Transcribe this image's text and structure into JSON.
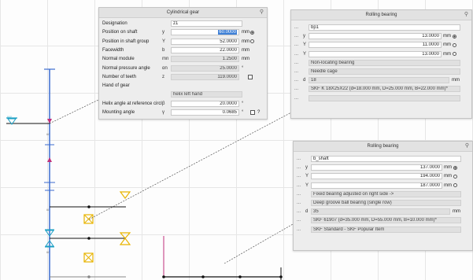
{
  "cylindrical_gear": {
    "title": "Cylindrical gear",
    "fields": [
      {
        "label": "Designation",
        "symbol": "",
        "value": "z1",
        "unit": "",
        "type": "text"
      },
      {
        "label": "Position on shaft",
        "symbol": "y",
        "value": "60.0000",
        "unit": "mm",
        "type": "num-selected",
        "radio": "on"
      },
      {
        "label": "Position in shaft group",
        "symbol": "Y",
        "value": "52.0000",
        "unit": "mm",
        "type": "num",
        "radio": "off"
      },
      {
        "label": "Facewidth",
        "symbol": "b",
        "value": "22.0000",
        "unit": "mm",
        "type": "num"
      },
      {
        "label": "Normal module",
        "symbol": "mn",
        "value": "1.2500",
        "unit": "mm",
        "type": "num-ro"
      },
      {
        "label": "Normal pressure angle",
        "symbol": "αn",
        "value": "25.0000",
        "unit": "°",
        "type": "num-ro"
      },
      {
        "label": "Number of teeth",
        "symbol": "z",
        "value": "119.0000",
        "unit": "",
        "type": "num-ro",
        "check": true
      },
      {
        "label": "Hand of gear",
        "symbol": "",
        "value": "",
        "unit": "",
        "type": "none"
      },
      {
        "label": "",
        "symbol": "",
        "value": "helix left hand",
        "unit": "",
        "type": "text-ro"
      },
      {
        "label": "Helix angle at reference circle",
        "symbol": "β",
        "value": "20.0000",
        "unit": "°",
        "type": "num"
      },
      {
        "label": "Mounting angle",
        "symbol": "γ",
        "value": "0.0685",
        "unit": "°",
        "type": "num",
        "check": true,
        "extra": "?"
      }
    ]
  },
  "rolling_bearing_1": {
    "title": "Rolling bearing",
    "rows": [
      {
        "dots": "...",
        "symbol": "",
        "value": "bp1",
        "unit": "",
        "type": "text"
      },
      {
        "dots": "...",
        "symbol": "y",
        "value": "13.0000",
        "unit": "mm",
        "type": "num",
        "radio": "on"
      },
      {
        "dots": "...",
        "symbol": "Y",
        "value": "11.0000",
        "unit": "mm",
        "type": "num",
        "radio": "off"
      },
      {
        "dots": "...",
        "symbol": "Y",
        "value": "13.0000",
        "unit": "mm",
        "type": "num",
        "radio": "off"
      },
      {
        "dots": "...",
        "symbol": "",
        "value": "Non-locating bearing",
        "unit": "",
        "type": "text-ro"
      },
      {
        "dots": "...",
        "symbol": "",
        "value": "Needle cage",
        "unit": "",
        "type": "text-ro"
      },
      {
        "dots": "...",
        "symbol": "d",
        "value": "18",
        "unit": "mm",
        "type": "text-ro"
      },
      {
        "dots": "...",
        "symbol": "",
        "value": "SKF K 18X25X22 (d=18.000 mm, D=25.000 mm, B=22.000 mm)*",
        "unit": "",
        "type": "text-ro"
      },
      {
        "dots": "...",
        "symbol": "",
        "value": "",
        "unit": "",
        "type": "text-ro"
      }
    ]
  },
  "rolling_bearing_2": {
    "title": "Rolling bearing",
    "rows": [
      {
        "dots": "...",
        "symbol": "",
        "value": "b_shaft",
        "unit": "",
        "type": "text"
      },
      {
        "dots": "...",
        "symbol": "y",
        "value": "137.0000",
        "unit": "mm",
        "type": "num",
        "radio": "on"
      },
      {
        "dots": "...",
        "symbol": "Y",
        "value": "194.0000",
        "unit": "mm",
        "type": "num",
        "radio": "off"
      },
      {
        "dots": "...",
        "symbol": "Y",
        "value": "187.0000",
        "unit": "mm",
        "type": "num",
        "radio": "off"
      },
      {
        "dots": "...",
        "symbol": "",
        "value": "Fixed bearing adjusted on right side ->",
        "unit": "",
        "type": "text-ro"
      },
      {
        "dots": "...",
        "symbol": "",
        "value": "Deep groove ball bearing (single row)",
        "unit": "",
        "type": "text-ro"
      },
      {
        "dots": "...",
        "symbol": "d",
        "value": "35",
        "unit": "mm",
        "type": "text-ro"
      },
      {
        "dots": "...",
        "symbol": "",
        "value": "SKF 61907 (d=35.000 mm, D=55.000 mm, B=10.000 mm)*",
        "unit": "",
        "type": "text-ro"
      },
      {
        "dots": "...",
        "symbol": "",
        "value": "SKF Standard - SKF Popular Item",
        "unit": "",
        "type": "text-ro"
      }
    ]
  },
  "colors": {
    "shaft": "#3a6bd0",
    "bearing": "#e8b400",
    "load": "#c0307a",
    "panel": "#ededed"
  },
  "icons": [
    "pin-icon",
    "support-icon",
    "bearing-icon",
    "radio-icon",
    "checkbox-icon",
    "help-icon"
  ]
}
